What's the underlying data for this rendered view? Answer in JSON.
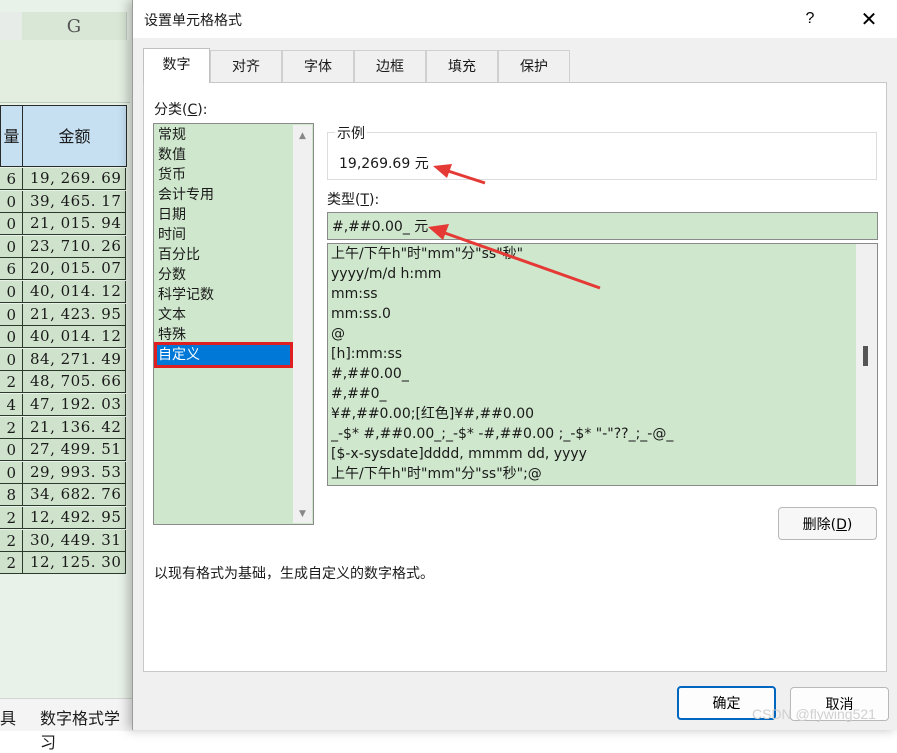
{
  "spreadsheet": {
    "column_letter": "G",
    "left_header_fragment": "量",
    "amount_header": "金额",
    "rows": [
      {
        "left": "6",
        "amount": "19, 269. 69"
      },
      {
        "left": "0",
        "amount": "39, 465. 17"
      },
      {
        "left": "0",
        "amount": "21, 015. 94"
      },
      {
        "left": "0",
        "amount": "23, 710. 26"
      },
      {
        "left": "6",
        "amount": "20, 015. 07"
      },
      {
        "left": "0",
        "amount": "40, 014. 12"
      },
      {
        "left": "0",
        "amount": "21, 423. 95"
      },
      {
        "left": "0",
        "amount": "40, 014. 12"
      },
      {
        "left": "0",
        "amount": "84, 271. 49"
      },
      {
        "left": "2",
        "amount": "48, 705. 66"
      },
      {
        "left": "4",
        "amount": "47, 192. 03"
      },
      {
        "left": "2",
        "amount": "21, 136. 42"
      },
      {
        "left": "0",
        "amount": "27, 499. 51"
      },
      {
        "left": "0",
        "amount": "29, 993. 53"
      },
      {
        "left": "8",
        "amount": "34, 682. 76"
      },
      {
        "left": "2",
        "amount": "12, 492. 95"
      },
      {
        "left": "2",
        "amount": "30, 449. 31"
      },
      {
        "left": "2",
        "amount": "12, 125. 30"
      }
    ],
    "sheet_tabs": [
      "具",
      "数字格式学习"
    ]
  },
  "dialog": {
    "title": "设置单元格格式",
    "help": "?",
    "close": "✕",
    "tabs": [
      "数字",
      "对齐",
      "字体",
      "边框",
      "填充",
      "保护"
    ],
    "active_tab": 0,
    "category_label": "分类(",
    "category_label_key": "C",
    "category_label_end": "):",
    "categories": [
      "常规",
      "数值",
      "货币",
      "会计专用",
      "日期",
      "时间",
      "百分比",
      "分数",
      "科学记数",
      "文本",
      "特殊",
      "自定义"
    ],
    "selected_category": 11,
    "sample_label": "示例",
    "sample_value": "19,269.69 元",
    "type_label": "类型(",
    "type_label_key": "T",
    "type_label_end": "):",
    "type_value": "#,##0.00_ 元",
    "format_list": [
      "上午/下午h\"时\"mm\"分\"ss\"秒\"",
      "yyyy/m/d h:mm",
      "mm:ss",
      "mm:ss.0",
      "@",
      "[h]:mm:ss",
      "#,##0.00_",
      "#,##0_",
      "¥#,##0.00;[红色]¥#,##0.00",
      "_-$* #,##0.00_;_-$* -#,##0.00 ;_-$* \"-\"??_;_-@_",
      "[$-x-sysdate]dddd, mmmm dd, yyyy",
      "上午/下午h\"时\"mm\"分\"ss\"秒\";@"
    ],
    "delete_label": "删除(",
    "delete_key": "D",
    "delete_end": ")",
    "description": "以现有格式为基础，生成自定义的数字格式。",
    "ok": "确定",
    "cancel": "取消"
  },
  "watermark": "CSDN @flywing521",
  "colors": {
    "accent": "#0078d7",
    "highlight_outline": "#e02020",
    "arrow": "#e53935",
    "list_bg": "#cfe7cc"
  }
}
